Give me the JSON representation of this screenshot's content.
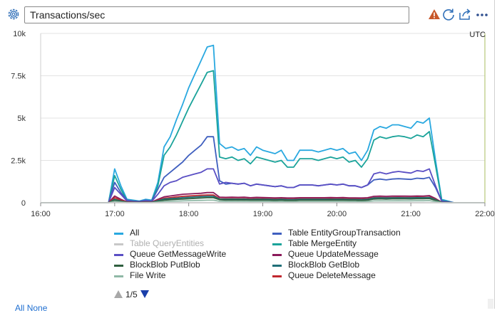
{
  "header": {
    "title": "Transactions/sec",
    "icons": [
      "gear-icon",
      "warning-icon",
      "refresh-icon",
      "share-icon",
      "more-icon"
    ]
  },
  "chart": {
    "timezone": "UTC"
  },
  "chart_data": {
    "type": "line",
    "x": [
      "16:00",
      "16:10",
      "16:20",
      "16:30",
      "16:40",
      "16:50",
      "16:55",
      "17:00",
      "17:05",
      "17:10",
      "17:15",
      "17:20",
      "17:25",
      "17:30",
      "17:35",
      "17:40",
      "17:45",
      "17:50",
      "17:55",
      "18:00",
      "18:05",
      "18:10",
      "18:15",
      "18:20",
      "18:25",
      "18:30",
      "18:35",
      "18:40",
      "18:45",
      "18:50",
      "18:55",
      "19:00",
      "19:05",
      "19:10",
      "19:15",
      "19:20",
      "19:25",
      "19:30",
      "19:35",
      "19:40",
      "19:45",
      "19:50",
      "19:55",
      "20:00",
      "20:05",
      "20:10",
      "20:15",
      "20:20",
      "20:25",
      "20:30",
      "20:35",
      "20:40",
      "20:45",
      "20:50",
      "20:55",
      "21:00",
      "21:05",
      "21:10",
      "21:15",
      "21:20",
      "21:25",
      "21:30",
      "21:35",
      "21:40",
      "21:50",
      "22:00"
    ],
    "x_ticks": [
      "16:00",
      "17:00",
      "18:00",
      "19:00",
      "20:00",
      "21:00",
      "22:00"
    ],
    "y_ticks": [
      "0",
      "2.5k",
      "5k",
      "7.5k",
      "10k"
    ],
    "ylim": [
      0,
      10000
    ],
    "grid": true,
    "legend_position": "bottom",
    "series": [
      {
        "name": "All",
        "color": "#29a8e0",
        "values": [
          0,
          0,
          0,
          0,
          0,
          0,
          0,
          2000,
          1000,
          200,
          150,
          100,
          200,
          150,
          1200,
          3300,
          3900,
          4900,
          5800,
          6800,
          7600,
          8400,
          9200,
          9300,
          3500,
          3200,
          3300,
          3100,
          3200,
          2800,
          3300,
          3100,
          3000,
          2900,
          3100,
          2500,
          2500,
          3100,
          3100,
          3100,
          3000,
          3100,
          3200,
          3100,
          3200,
          2900,
          3000,
          2500,
          3100,
          4300,
          4500,
          4400,
          4600,
          4600,
          4500,
          4400,
          4800,
          4700,
          5000,
          2500,
          200,
          100,
          0,
          0,
          0,
          0
        ]
      },
      {
        "name": "Table QueryEntities",
        "color": "#c8c8c8",
        "values": [
          0,
          0,
          0,
          0,
          0,
          0,
          0,
          0,
          0,
          0,
          0,
          0,
          0,
          0,
          0,
          0,
          0,
          0,
          0,
          0,
          0,
          0,
          0,
          0,
          0,
          0,
          0,
          0,
          0,
          0,
          0,
          0,
          0,
          0,
          0,
          0,
          0,
          0,
          0,
          0,
          0,
          0,
          0,
          0,
          0,
          0,
          0,
          0,
          0,
          0,
          0,
          0,
          0,
          0,
          0,
          0,
          0,
          0,
          0,
          0,
          0,
          0,
          0,
          0,
          0,
          0
        ]
      },
      {
        "name": "Queue GetMessageWrite",
        "color": "#5a4fc4",
        "values": [
          0,
          0,
          0,
          0,
          0,
          0,
          0,
          900,
          500,
          100,
          80,
          60,
          100,
          80,
          500,
          1000,
          1200,
          1300,
          1500,
          1600,
          1700,
          1800,
          2000,
          2000,
          1100,
          1200,
          1150,
          1100,
          1150,
          1000,
          1100,
          1050,
          1000,
          950,
          1000,
          900,
          900,
          1050,
          1050,
          1050,
          1000,
          1050,
          1100,
          1050,
          1100,
          1000,
          1000,
          900,
          1050,
          1700,
          1800,
          1700,
          1800,
          1850,
          1800,
          1750,
          1900,
          1850,
          2000,
          1000,
          100,
          50,
          0,
          0,
          0,
          0
        ]
      },
      {
        "name": "BlockBlob PutBlob",
        "color": "#2f5f3f",
        "values": [
          0,
          0,
          0,
          0,
          0,
          0,
          0,
          150,
          80,
          20,
          20,
          10,
          20,
          20,
          80,
          150,
          180,
          200,
          220,
          240,
          260,
          280,
          300,
          300,
          180,
          160,
          170,
          160,
          170,
          150,
          160,
          155,
          150,
          140,
          150,
          130,
          130,
          150,
          150,
          150,
          150,
          150,
          155,
          150,
          155,
          145,
          145,
          130,
          150,
          220,
          230,
          220,
          230,
          235,
          230,
          225,
          240,
          235,
          250,
          140,
          20,
          10,
          0,
          0,
          0,
          0
        ]
      },
      {
        "name": "File Write",
        "color": "#8fb8a6",
        "values": [
          0,
          0,
          0,
          0,
          0,
          0,
          0,
          80,
          40,
          10,
          10,
          5,
          10,
          10,
          40,
          80,
          90,
          100,
          110,
          120,
          130,
          140,
          150,
          150,
          90,
          80,
          85,
          80,
          85,
          75,
          80,
          78,
          75,
          70,
          75,
          65,
          65,
          75,
          75,
          75,
          75,
          75,
          78,
          75,
          78,
          72,
          72,
          65,
          75,
          110,
          115,
          110,
          115,
          118,
          115,
          112,
          120,
          118,
          125,
          70,
          10,
          5,
          0,
          0,
          0,
          0
        ]
      },
      {
        "name": "Table EntityGroupTransaction",
        "color": "#3f5fbf",
        "values": [
          0,
          0,
          0,
          0,
          0,
          0,
          0,
          1200,
          600,
          150,
          100,
          80,
          150,
          100,
          800,
          1500,
          1800,
          2100,
          2400,
          2800,
          3100,
          3400,
          3900,
          3900,
          1300,
          1100,
          1150,
          1100,
          1150,
          1000,
          1100,
          1050,
          1000,
          950,
          1000,
          900,
          900,
          1050,
          1050,
          1050,
          1000,
          1050,
          1100,
          1050,
          1100,
          1000,
          1000,
          900,
          1050,
          1350,
          1400,
          1350,
          1400,
          1420,
          1400,
          1380,
          1450,
          1420,
          1500,
          900,
          100,
          50,
          0,
          0,
          0,
          0
        ]
      },
      {
        "name": "Table MergeEntity",
        "color": "#1aa39a",
        "values": [
          0,
          0,
          0,
          0,
          0,
          0,
          0,
          1600,
          800,
          150,
          120,
          90,
          150,
          120,
          1000,
          2800,
          3300,
          4000,
          4800,
          5600,
          6300,
          7000,
          7700,
          7800,
          2700,
          2600,
          2700,
          2500,
          2600,
          2300,
          2700,
          2600,
          2500,
          2400,
          2500,
          2100,
          2100,
          2600,
          2600,
          2600,
          2500,
          2600,
          2700,
          2600,
          2700,
          2400,
          2500,
          2100,
          2600,
          3700,
          3900,
          3800,
          3900,
          3950,
          3900,
          3800,
          4000,
          3900,
          4200,
          2200,
          150,
          80,
          0,
          0,
          0,
          0
        ]
      },
      {
        "name": "Queue UpdateMessage",
        "color": "#8b1a5a",
        "values": [
          0,
          0,
          0,
          0,
          0,
          0,
          0,
          400,
          200,
          50,
          40,
          30,
          50,
          40,
          200,
          350,
          400,
          450,
          500,
          520,
          540,
          560,
          600,
          600,
          330,
          320,
          330,
          320,
          330,
          300,
          320,
          310,
          300,
          290,
          300,
          280,
          280,
          300,
          300,
          300,
          300,
          300,
          310,
          300,
          310,
          290,
          290,
          280,
          300,
          380,
          390,
          380,
          390,
          395,
          390,
          385,
          400,
          395,
          420,
          250,
          30,
          15,
          0,
          0,
          0,
          0
        ]
      },
      {
        "name": "BlockBlob GetBlob",
        "color": "#1f6f78",
        "values": [
          0,
          0,
          0,
          0,
          0,
          0,
          0,
          200,
          100,
          30,
          25,
          20,
          30,
          25,
          120,
          220,
          250,
          270,
          300,
          320,
          340,
          360,
          380,
          380,
          220,
          210,
          215,
          210,
          215,
          195,
          210,
          205,
          200,
          190,
          200,
          180,
          180,
          200,
          200,
          200,
          200,
          200,
          205,
          200,
          205,
          195,
          195,
          180,
          200,
          280,
          290,
          280,
          290,
          295,
          290,
          285,
          300,
          295,
          310,
          180,
          25,
          12,
          0,
          0,
          0,
          0
        ]
      },
      {
        "name": "Queue DeleteMessage",
        "color": "#c0282f",
        "values": [
          0,
          0,
          0,
          0,
          0,
          0,
          0,
          300,
          150,
          40,
          30,
          25,
          40,
          30,
          150,
          260,
          300,
          340,
          380,
          400,
          420,
          440,
          460,
          460,
          250,
          240,
          245,
          240,
          245,
          225,
          240,
          235,
          230,
          220,
          230,
          210,
          210,
          230,
          230,
          230,
          230,
          230,
          235,
          230,
          235,
          225,
          225,
          210,
          230,
          300,
          310,
          300,
          310,
          315,
          310,
          305,
          320,
          315,
          330,
          200,
          25,
          12,
          0,
          0,
          0,
          0
        ]
      }
    ]
  },
  "legend": {
    "items": [
      {
        "label": "All",
        "color": "#29a8e0",
        "enabled": true
      },
      {
        "label": "Table EntityGroupTransaction",
        "color": "#3f5fbf",
        "enabled": true
      },
      {
        "label": "Table QueryEntities",
        "color": "#c8c8c8",
        "enabled": false
      },
      {
        "label": "Table MergeEntity",
        "color": "#1aa39a",
        "enabled": true
      },
      {
        "label": "Queue GetMessageWrite",
        "color": "#5a4fc4",
        "enabled": true
      },
      {
        "label": "Queue UpdateMessage",
        "color": "#8b1a5a",
        "enabled": true
      },
      {
        "label": "BlockBlob PutBlob",
        "color": "#2f5f3f",
        "enabled": true
      },
      {
        "label": "BlockBlob GetBlob",
        "color": "#1f6f78",
        "enabled": true
      },
      {
        "label": "File Write",
        "color": "#8fb8a6",
        "enabled": true
      },
      {
        "label": "Queue DeleteMessage",
        "color": "#c0282f",
        "enabled": true
      }
    ],
    "page": "1/5"
  },
  "footer": {
    "all_label": "All",
    "none_label": "None"
  }
}
